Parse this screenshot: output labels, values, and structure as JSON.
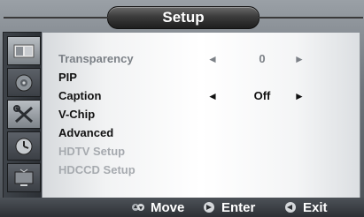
{
  "title": "Setup",
  "sidebar": {
    "tabs": [
      {
        "icon": "picture-icon"
      },
      {
        "icon": "sound-icon"
      },
      {
        "icon": "tools-icon"
      },
      {
        "icon": "clock-icon"
      },
      {
        "icon": "tv-icon"
      }
    ]
  },
  "menu": {
    "items": [
      {
        "label": "Transparency",
        "value": "0",
        "left_arrow": "◄",
        "right_arrow": "►"
      },
      {
        "label": "PIP"
      },
      {
        "label": "Caption",
        "value": "Off",
        "left_arrow": "◄",
        "right_arrow": "►"
      },
      {
        "label": "V-Chip"
      },
      {
        "label": "Advanced"
      },
      {
        "label": "HDTV Setup"
      },
      {
        "label": "HDCCD Setup"
      }
    ]
  },
  "footer": {
    "move_label": "Move",
    "enter_label": "Enter",
    "exit_label": "Exit"
  }
}
